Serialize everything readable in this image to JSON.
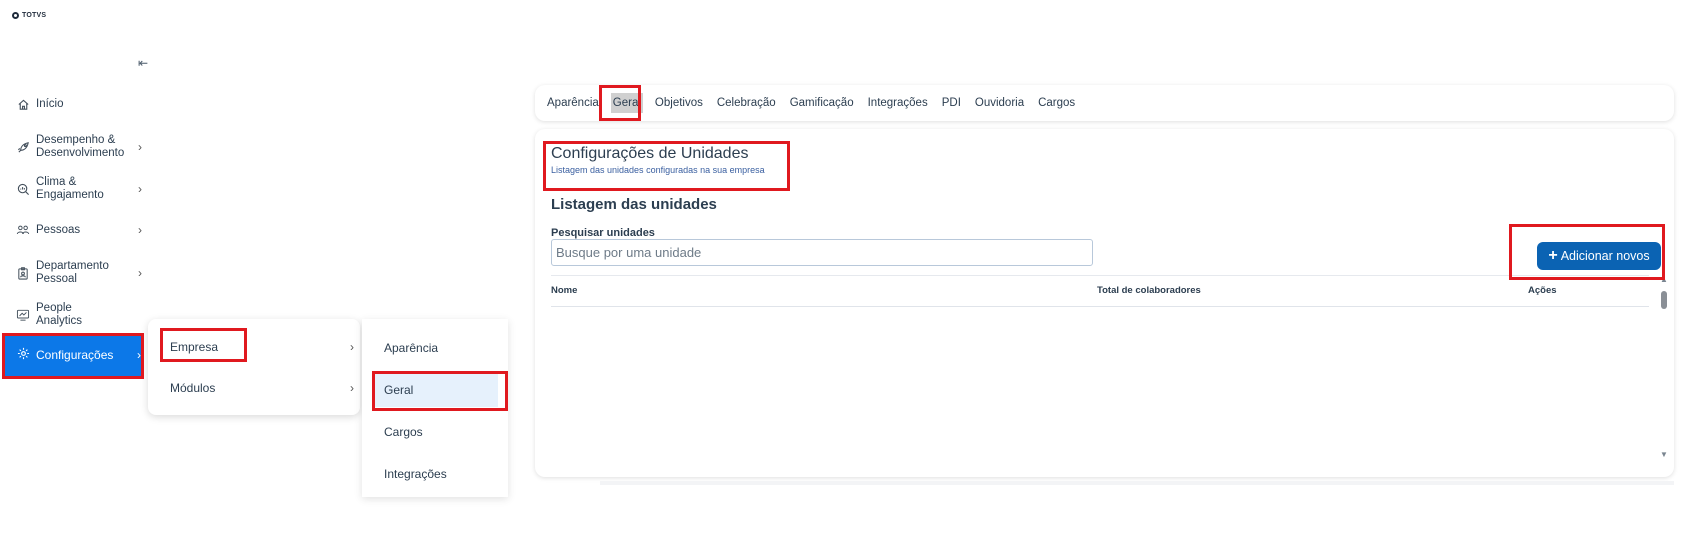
{
  "app": {
    "logo_text": "TOTVS"
  },
  "sidebar": {
    "collapse_icon": "collapse-left-icon",
    "items": [
      {
        "label": "Início",
        "icon": "home-icon"
      },
      {
        "label": "Desempenho & Desenvolvimento",
        "line1": "Desempenho &",
        "line2": "Desenvolvimento",
        "icon": "rocket-icon"
      },
      {
        "label": "Clima & Engajamento",
        "line1": "Clima &",
        "line2": "Engajamento",
        "icon": "search-chart-icon"
      },
      {
        "label": "Pessoas",
        "icon": "people-icon"
      },
      {
        "label": "Departamento Pessoal",
        "line1": "Departamento",
        "line2": "Pessoal",
        "icon": "id-badge-icon"
      },
      {
        "label": "People Analytics",
        "line1": "People",
        "line2": "Analytics",
        "icon": "analytics-icon"
      },
      {
        "label": "Configurações",
        "icon": "gear-icon",
        "active": true
      }
    ]
  },
  "submenu_level1": {
    "items": [
      {
        "label": "Empresa"
      },
      {
        "label": "Módulos"
      }
    ]
  },
  "submenu_level2": {
    "items": [
      {
        "label": "Aparência"
      },
      {
        "label": "Geral"
      },
      {
        "label": "Cargos"
      },
      {
        "label": "Integrações"
      }
    ]
  },
  "tabs": [
    {
      "label": "Aparência"
    },
    {
      "label": "Geral",
      "active": true
    },
    {
      "label": "Objetivos"
    },
    {
      "label": "Celebração"
    },
    {
      "label": "Gamificação"
    },
    {
      "label": "Integrações"
    },
    {
      "label": "PDI"
    },
    {
      "label": "Ouvidoria"
    },
    {
      "label": "Cargos"
    }
  ],
  "main": {
    "title": "Configurações de Unidades",
    "subtitle": "Listagem das unidades configuradas na sua empresa",
    "section_title": "Listagem das unidades",
    "search": {
      "label": "Pesquisar unidades",
      "placeholder": "Busque por uma unidade",
      "value": ""
    },
    "add_button": "Adicionar novos",
    "table": {
      "columns": [
        "Nome",
        "Total de colaboradores",
        "Ações"
      ],
      "rows": []
    }
  },
  "colors": {
    "accent": "#0c78e8",
    "button": "#0b63b3",
    "highlight": "#e0191f"
  }
}
